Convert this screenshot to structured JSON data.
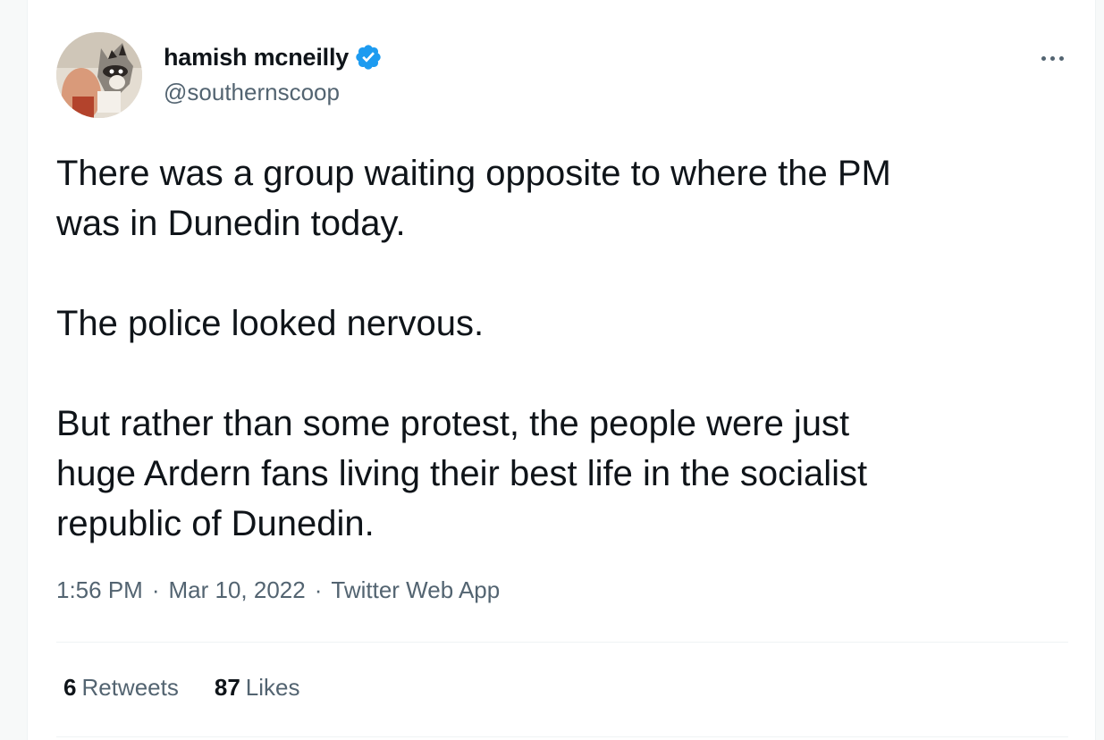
{
  "tweet": {
    "author": {
      "name": "hamish mcneilly",
      "handle": "@southernscoop",
      "verified": true,
      "verified_badge_color": "#1d9bf0",
      "avatar_icon": "avatar-photo"
    },
    "more_icon": "ellipsis-icon",
    "text": {
      "line1": "There was a group waiting opposite to where the PM",
      "line2": "was in Dunedin today.",
      "line3": "The police looked nervous.",
      "line4": "But rather than some protest, the people were just",
      "line5": "huge Ardern fans living their best life in the socialist",
      "line6": "republic of Dunedin."
    },
    "meta": {
      "time": "1:56 PM",
      "date": "Mar 10, 2022",
      "source": "Twitter Web App",
      "separator": "·"
    },
    "stats": {
      "retweets_count": "6",
      "retweets_label": "Retweets",
      "likes_count": "87",
      "likes_label": "Likes"
    }
  },
  "colors": {
    "text_primary": "#0f1419",
    "text_secondary": "#536471",
    "divider": "#eff3f4",
    "accent": "#1d9bf0"
  }
}
